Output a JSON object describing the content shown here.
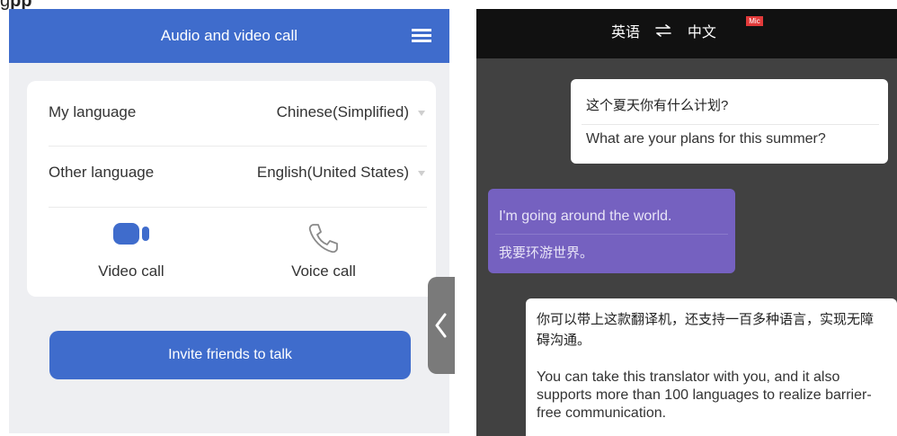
{
  "caption": {
    "left": "g",
    "bold": "pp"
  },
  "left": {
    "header": {
      "title": "Audio and video call",
      "menu_icon": "menu-list-icon"
    },
    "settings": {
      "my_language_label": "My language",
      "my_language_value": "Chinese(Simplified)",
      "other_language_label": "Other language",
      "other_language_value": "English(United States)"
    },
    "calls": {
      "video_label": "Video call",
      "video_icon": "video-camera-icon",
      "voice_label": "Voice call",
      "voice_icon": "phone-icon"
    },
    "invite_label": "Invite friends to talk",
    "collapse_icon": "chevron-left-icon",
    "colors": {
      "accent": "#3f6ccc",
      "background": "#eeeff2"
    }
  },
  "right": {
    "header": {
      "source_lang": "英语",
      "swap_icon": "swap-arrows-icon",
      "target_lang": "中文",
      "badge": "Mic"
    },
    "messages": [
      {
        "original": "这个夏天你有什么计划?",
        "translation": "What are your plans for this summer?"
      },
      {
        "original": "I'm going around the world.",
        "translation": "我要环游世界。"
      },
      {
        "original": "你可以带上这款翻译机，还支持一百多种语言，实现无障碍沟通。",
        "translation": "You can take this translator with you, and it also supports more than 100 languages to realize barrier-free communication."
      }
    ],
    "colors": {
      "background": "#414141",
      "header": "#111111",
      "purple_bubble": "#7561c0",
      "badge": "#e23a3a"
    }
  }
}
